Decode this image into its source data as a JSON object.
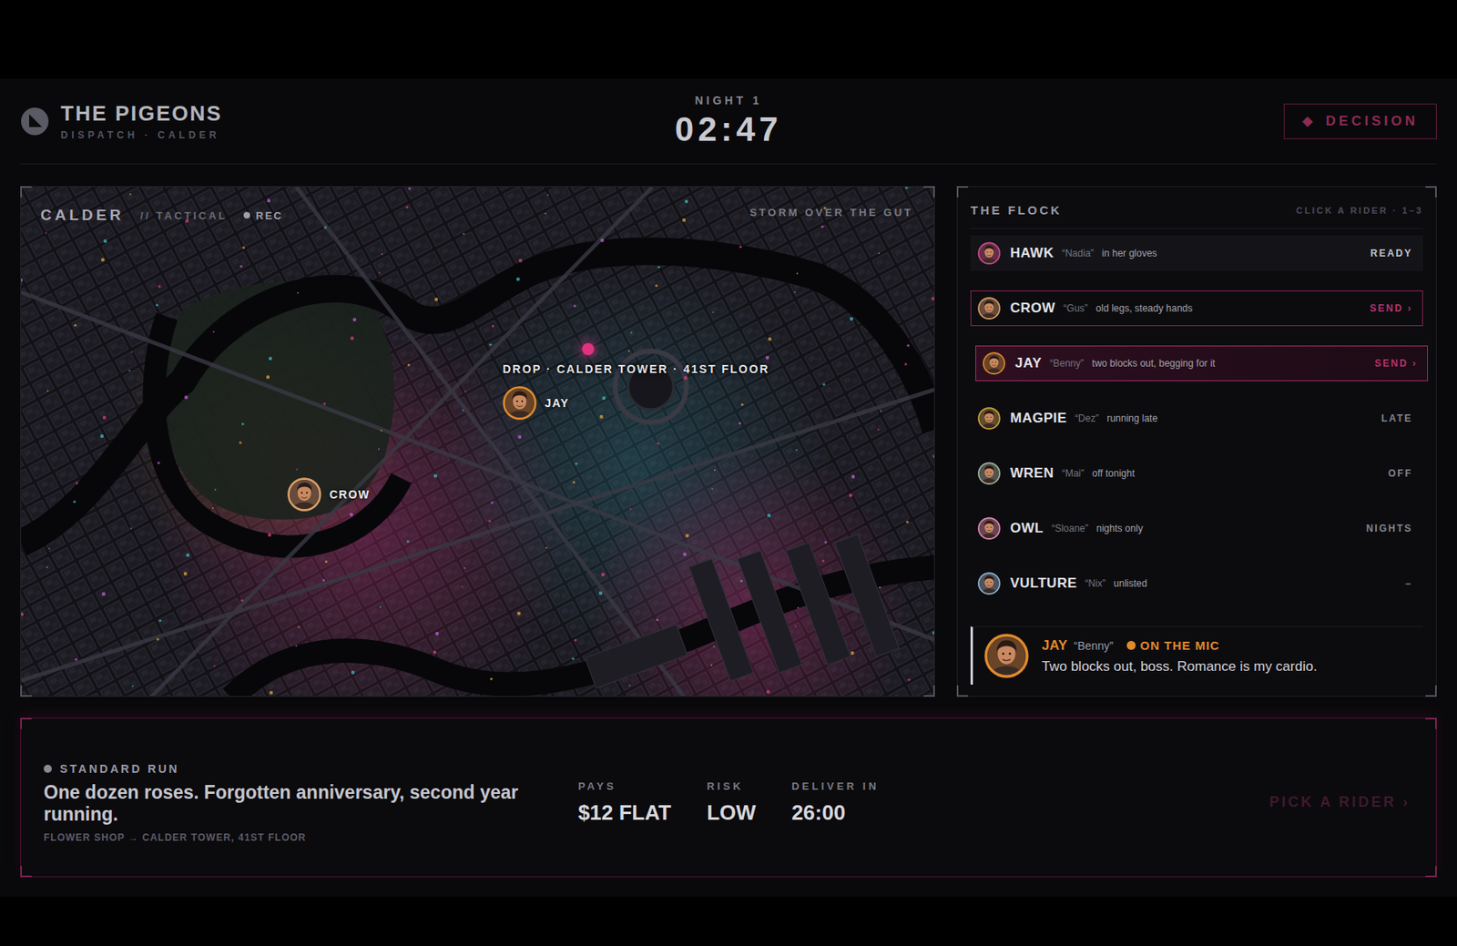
{
  "header": {
    "logo_title": "THE PIGEONS",
    "logo_subtitle": "DISPATCH · CALDER",
    "night": "NIGHT 1",
    "clock": "02:47",
    "decision_button": {
      "icon": "◆",
      "label": "DECISION"
    }
  },
  "map": {
    "title": "CALDER",
    "mode": "// TACTICAL",
    "rec": "REC",
    "weather": "STORM OVER THE GUT",
    "drop_label": "DROP · CALDER TOWER · 41ST FLOOR",
    "pins": [
      {
        "label": "JAY",
        "color": "#e08a2c"
      },
      {
        "label": "CROW",
        "color": "#d9a066"
      }
    ]
  },
  "flock": {
    "title": "THE FLOCK",
    "hint": "CLICK A RIDER · 1–3",
    "riders": [
      {
        "name": "HAWK",
        "alias": "“Nadia”",
        "note": "in her gloves",
        "status": "READY",
        "kind": "ready",
        "selected": false,
        "color": "#d04a8a"
      },
      {
        "name": "CROW",
        "alias": "“Gus”",
        "note": "old legs, steady hands",
        "status": "SEND ›",
        "kind": "send",
        "selected": false,
        "color": "#d9a066"
      },
      {
        "name": "JAY",
        "alias": "“Benny”",
        "note": "two blocks out, begging for it",
        "status": "SEND ›",
        "kind": "send",
        "selected": true,
        "color": "#e08a2c"
      },
      {
        "name": "MAGPIE",
        "alias": "“Dez”",
        "note": "running late",
        "status": "LATE",
        "kind": "unavailable",
        "selected": false,
        "color": "#c9a23a"
      },
      {
        "name": "WREN",
        "alias": "“Mai”",
        "note": "off tonight",
        "status": "OFF",
        "kind": "unavailable",
        "selected": false,
        "color": "#9fb59a"
      },
      {
        "name": "OWL",
        "alias": "“Sloane”",
        "note": "nights only",
        "status": "NIGHTS",
        "kind": "unavailable",
        "selected": false,
        "color": "#e08ab0"
      },
      {
        "name": "VULTURE",
        "alias": "“Nix”",
        "note": "unlisted",
        "status": "–",
        "kind": "unavailable",
        "selected": false,
        "color": "#8fb4cc"
      }
    ]
  },
  "mic": {
    "name": "JAY",
    "alias": "“Benny”",
    "status": "ON THE MIC",
    "quote": "Two blocks out, boss. Romance is my cardio.",
    "color": "#e08a2c"
  },
  "job": {
    "tag": "STANDARD RUN",
    "title": "One dozen roses. Forgotten anniversary, second year running.",
    "route": "FLOWER SHOP → CALDER TOWER, 41ST FLOOR",
    "stats": [
      {
        "label": "PAYS",
        "value": "$12 FLAT"
      },
      {
        "label": "RISK",
        "value": "LOW"
      },
      {
        "label": "DELIVER IN",
        "value": "26:00"
      }
    ],
    "action": {
      "label": "PICK A RIDER ›",
      "disabled": true
    }
  }
}
